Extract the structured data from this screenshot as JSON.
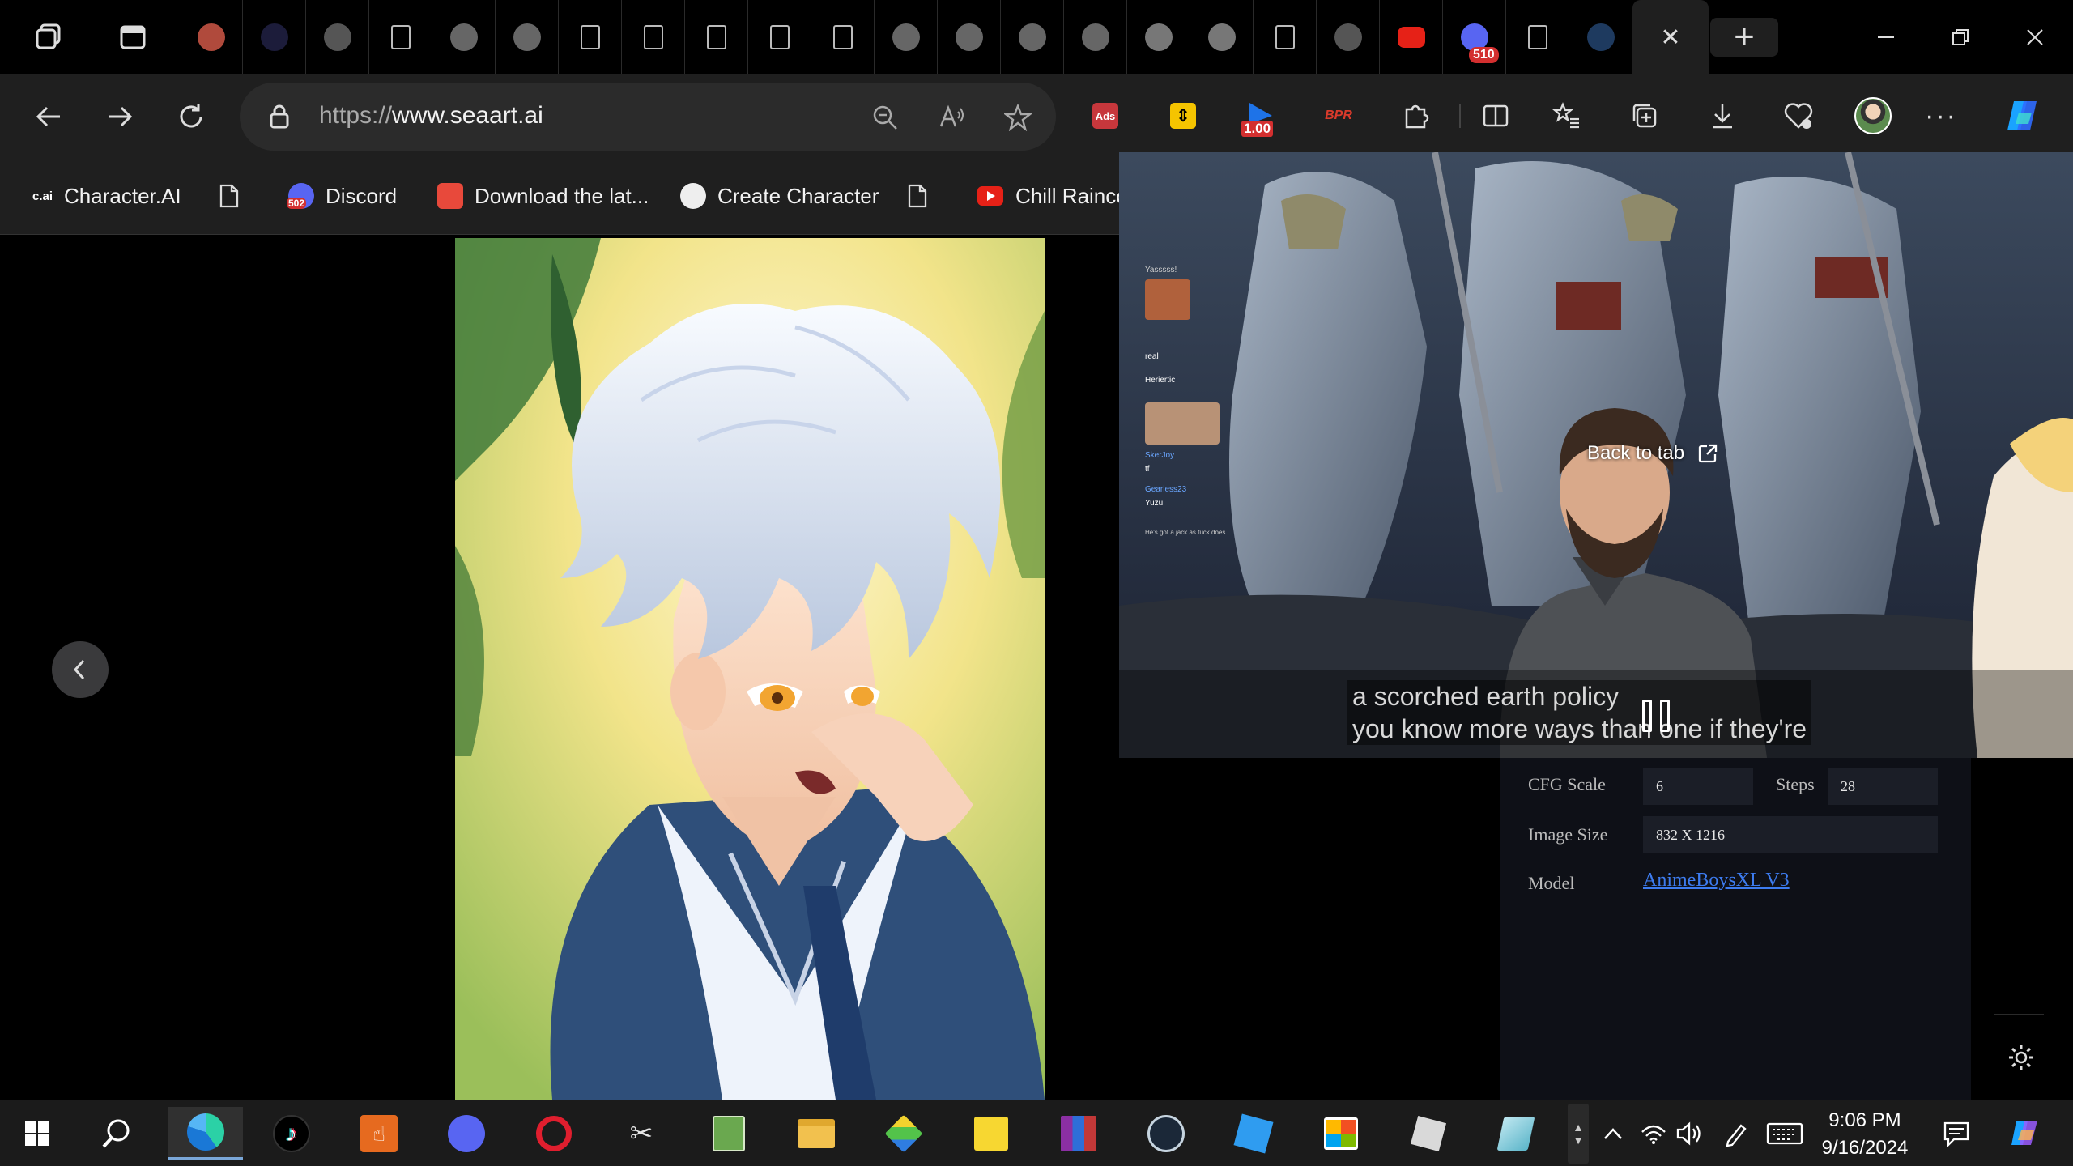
{
  "browser": {
    "tabs": [
      {
        "icon": "notes-icon",
        "color": "#b04a3c"
      },
      {
        "icon": "circle-dark-icon",
        "color": "#1c1c3a"
      },
      {
        "icon": "dice-icon",
        "color": "#555"
      },
      {
        "icon": "page-icon",
        "color": "#555"
      },
      {
        "icon": "seaart-icon",
        "color": "#666"
      },
      {
        "icon": "seaart-icon",
        "color": "#666"
      },
      {
        "icon": "page-icon",
        "color": "#555"
      },
      {
        "icon": "page-icon",
        "color": "#555"
      },
      {
        "icon": "page-icon",
        "color": "#555"
      },
      {
        "icon": "page-icon",
        "color": "#555"
      },
      {
        "icon": "page-icon",
        "color": "#555"
      },
      {
        "icon": "seaart-icon",
        "color": "#666"
      },
      {
        "icon": "seaart-icon",
        "color": "#666"
      },
      {
        "icon": "seaart-icon",
        "color": "#666"
      },
      {
        "icon": "seaart-icon",
        "color": "#666"
      },
      {
        "icon": "avatar-icon",
        "color": "#777"
      },
      {
        "icon": "avatar-icon",
        "color": "#777"
      },
      {
        "icon": "page-icon",
        "color": "#555"
      },
      {
        "icon": "pip-icon",
        "color": "#555"
      },
      {
        "icon": "youtube-icon",
        "color": "#e62117"
      },
      {
        "icon": "discord-icon",
        "color": "#5865f2",
        "badge": "510"
      },
      {
        "icon": "page-icon",
        "color": "#555"
      },
      {
        "icon": "search-icon",
        "color": "#1e3a5f"
      }
    ],
    "active_tab_close": "✕",
    "new_tab": "+",
    "url_prefix": "https://",
    "url_host": "www.seaart.ai",
    "extension_badge_speed": "1.00",
    "extension_ads_label": "Ads",
    "extension_bpr_label": "BPR"
  },
  "favorites": [
    {
      "label": "Character.AI",
      "icon": "c.ai"
    },
    {
      "label": "",
      "icon": "page-icon"
    },
    {
      "label": "Discord",
      "icon": "discord",
      "badge": "502"
    },
    {
      "label": "Download the lat...",
      "icon": "download-site-icon"
    },
    {
      "label": "Create Character",
      "icon": "create-character-icon"
    },
    {
      "label": "",
      "icon": "page-icon"
    },
    {
      "label": "Chill Raincoc",
      "icon": "youtube-icon"
    }
  ],
  "pip": {
    "back_to_tab": "Back to tab",
    "caption_line1": "a scorched earth policy",
    "caption_line2": "you know more ways than one if they're",
    "chat": [
      "Yasssss!",
      "real",
      "Heriertic",
      "SkerJoy",
      "tf",
      "Gearless23",
      "Yuzu",
      "He's got a jack as fuck does"
    ]
  },
  "details": {
    "cfg_label": "CFG Scale",
    "cfg_value": "6",
    "steps_label": "Steps",
    "steps_value": "28",
    "size_label": "Image Size",
    "size_value": "832 X 1216",
    "model_label": "Model",
    "model_value": "AnimeBoysXL V3"
  },
  "taskbar": {
    "time": "9:06 PM",
    "date": "9/16/2024"
  }
}
